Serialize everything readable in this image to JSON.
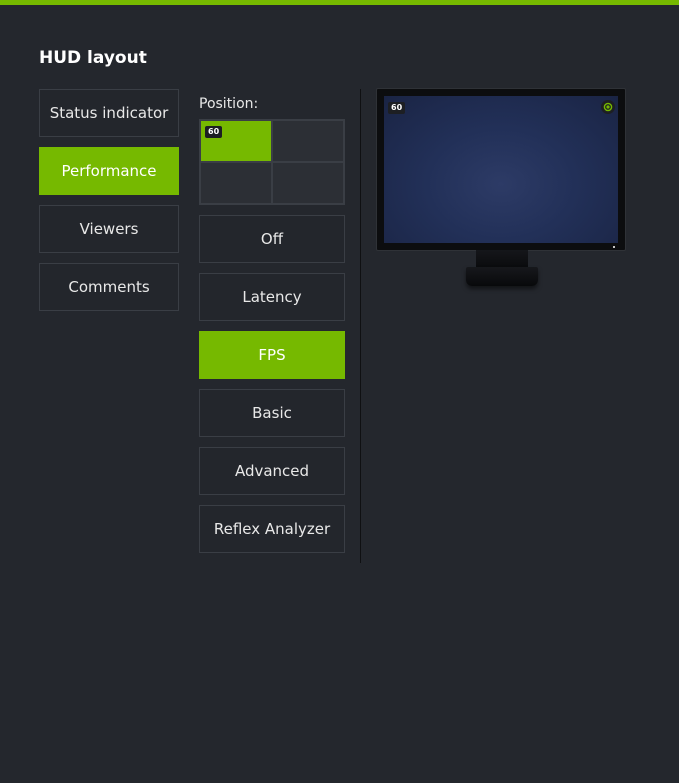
{
  "page": {
    "title": "HUD layout",
    "accent_color": "#76b900",
    "background_color": "#24272d"
  },
  "categories": [
    {
      "label": "Status indicator",
      "active": false
    },
    {
      "label": "Performance",
      "active": true
    },
    {
      "label": "Viewers",
      "active": false
    },
    {
      "label": "Comments",
      "active": false
    }
  ],
  "position": {
    "label": "Position:",
    "selected": "top-left",
    "cells": [
      "top-left",
      "top-right",
      "bottom-left",
      "bottom-right"
    ],
    "badge_text": "60"
  },
  "options": [
    {
      "label": "Off",
      "active": false
    },
    {
      "label": "Latency",
      "active": false
    },
    {
      "label": "FPS",
      "active": true
    },
    {
      "label": "Basic",
      "active": false
    },
    {
      "label": "Advanced",
      "active": false
    },
    {
      "label": "Reflex Analyzer",
      "active": false
    }
  ],
  "preview": {
    "fps_text": "60",
    "status_icon": "recording-status-icon",
    "screen_color": "#223058"
  }
}
